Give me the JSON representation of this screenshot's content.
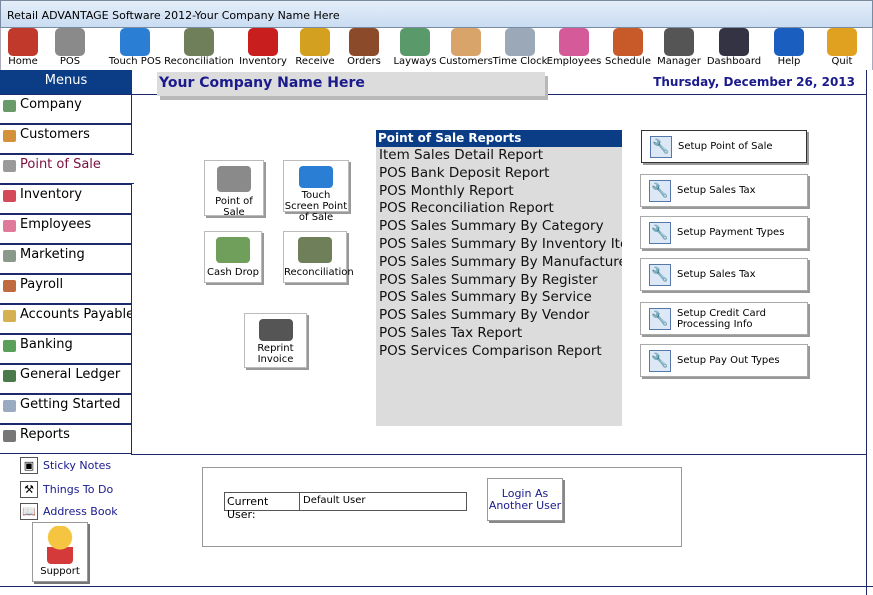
{
  "window": {
    "title": "Retail ADVANTAGE Software 2012-Your Company Name Here"
  },
  "toolbar": [
    {
      "label": "Home",
      "icon": "house-icon",
      "color": "#c0392b"
    },
    {
      "label": "POS",
      "icon": "cash-register-icon",
      "color": "#8a8a8a"
    },
    {
      "label": "Touch POS",
      "icon": "touch-screen-icon",
      "color": "#2a7fd4"
    },
    {
      "label": "Reconciliation",
      "icon": "money-coins-icon",
      "color": "#6f7f5a"
    },
    {
      "label": "Inventory",
      "icon": "box-icon",
      "color": "#c81e1e"
    },
    {
      "label": "Receive",
      "icon": "forklift-icon",
      "color": "#d4a020"
    },
    {
      "label": "Orders",
      "icon": "order-form-icon",
      "color": "#8b4a2a"
    },
    {
      "label": "Layways",
      "icon": "layaway-icon",
      "color": "#5a9a6a"
    },
    {
      "label": "Customers",
      "icon": "handshake-icon",
      "color": "#d9a46a"
    },
    {
      "label": "Time Clock",
      "icon": "clock-icon",
      "color": "#9aa8b8"
    },
    {
      "label": "Employees",
      "icon": "people-icon",
      "color": "#d45a9a"
    },
    {
      "label": "Schedule",
      "icon": "calendar-icon",
      "color": "#c85a2a"
    },
    {
      "label": "Manager",
      "icon": "manager-icon",
      "color": "#555555"
    },
    {
      "label": "Dashboard",
      "icon": "gauge-icon",
      "color": "#333344"
    },
    {
      "label": "Help",
      "icon": "help-icon",
      "color": "#1a5fc0"
    },
    {
      "label": "Quit",
      "icon": "exit-door-icon",
      "color": "#e0a020"
    }
  ],
  "sidebar": {
    "title": "Menus",
    "items": [
      {
        "label": "Company",
        "icon": "building-icon",
        "color": "#6a9a6a"
      },
      {
        "label": "Customers",
        "icon": "customers-icon",
        "color": "#d4903a"
      },
      {
        "label": "Point of Sale",
        "icon": "cart-icon",
        "color": "#9a9a9a",
        "active": true
      },
      {
        "label": "Inventory",
        "icon": "inventory-icon",
        "color": "#d44a5a"
      },
      {
        "label": "Employees",
        "icon": "employee-icon",
        "color": "#e07a9a"
      },
      {
        "label": "Marketing",
        "icon": "marketing-icon",
        "color": "#8a9a8a"
      },
      {
        "label": "Payroll",
        "icon": "payroll-icon",
        "color": "#c06a40"
      },
      {
        "label": "Accounts Payable",
        "icon": "accounts-payable-icon",
        "color": "#d4b050"
      },
      {
        "label": "Banking",
        "icon": "banking-icon",
        "color": "#5aa05a"
      },
      {
        "label": "General Ledger",
        "icon": "ledger-icon",
        "color": "#4a7a4a"
      },
      {
        "label": "Getting Started",
        "icon": "keyboard-icon",
        "color": "#9aaac0"
      },
      {
        "label": "Reports",
        "icon": "reports-icon",
        "color": "#777777"
      }
    ]
  },
  "bottom_links": [
    {
      "label": "Sticky Notes",
      "icon": "sticky-note-icon",
      "glyph": "▣"
    },
    {
      "label": "Things To Do",
      "icon": "hammer-icon",
      "glyph": "⚒"
    },
    {
      "label": "Address Book",
      "icon": "address-book-icon",
      "glyph": "📖"
    }
  ],
  "support": {
    "label": "Support"
  },
  "header": {
    "company": "Your Company Name Here",
    "date": "Thursday, December 26, 2013"
  },
  "pos_buttons": [
    {
      "label": "Point of Sale",
      "icon": "cash-register-icon",
      "color": "#8a8a8a"
    },
    {
      "label": "Touch Screen Point of Sale",
      "icon": "touch-screen-icon",
      "color": "#2a7fd4"
    },
    {
      "label": "Cash Drop",
      "icon": "cash-drop-icon",
      "color": "#6f9f5a"
    },
    {
      "label": "Reconciliation",
      "icon": "money-coins-icon",
      "color": "#6f7f5a"
    },
    {
      "label": "Reprint Invoice",
      "icon": "printer-icon",
      "color": "#555555"
    }
  ],
  "reports": {
    "title": "Point of Sale Reports",
    "items": [
      "Item Sales Detail Report",
      "POS Bank Deposit Report",
      "POS Monthly Report",
      "POS Reconciliation Report",
      "POS Sales Summary By Category",
      "POS Sales Summary By Inventory Item",
      "POS Sales Summary By Manufacturer",
      "POS Sales Summary By Register",
      "POS Sales Summary By Service",
      "POS Sales Summary By Vendor",
      "POS Sales Tax Report",
      "POS Services Comparison Report"
    ]
  },
  "setup_buttons": [
    "Setup Point of Sale",
    "Setup Sales Tax",
    "Setup Payment Types",
    "Setup Sales Tax",
    "Setup Credit Card Processing Info",
    "Setup Pay Out Types"
  ],
  "user": {
    "label": "Current User:",
    "value": "Default User",
    "login_button": "Login As Another User"
  }
}
